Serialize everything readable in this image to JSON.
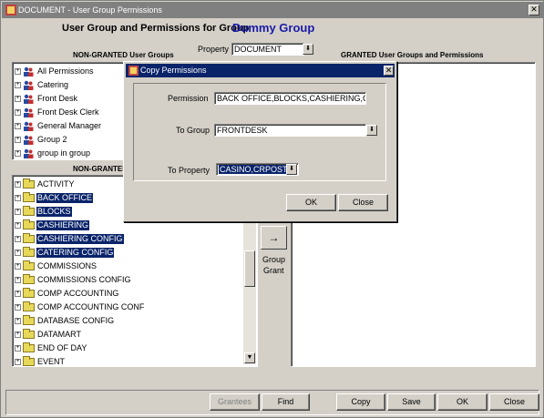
{
  "window": {
    "title": "DOCUMENT - User Group Permissions",
    "title_bar_color": "#808080"
  },
  "header": {
    "heading": "User Group and Permissions for Group",
    "group_name": "Dummy Group",
    "group_name_color": "#1a1aa8"
  },
  "property": {
    "label": "Property",
    "value": "DOCUMENT"
  },
  "panels": {
    "non_granted_groups_label": "NON-GRANTED User Groups",
    "granted_label": "GRANTED User Groups and Permissions",
    "non_granted_perms_label": "NON-GRANTED"
  },
  "user_groups": [
    {
      "label": "All Permissions",
      "selected": false
    },
    {
      "label": "Catering",
      "selected": false
    },
    {
      "label": "Front Desk",
      "selected": false
    },
    {
      "label": "Front Desk Clerk",
      "selected": false
    },
    {
      "label": "General Manager",
      "selected": false
    },
    {
      "label": "Group 2",
      "selected": false
    },
    {
      "label": "group in group",
      "selected": false
    }
  ],
  "permissions": [
    {
      "label": "ACTIVITY",
      "selected": false
    },
    {
      "label": "BACK OFFICE",
      "selected": true
    },
    {
      "label": "BLOCKS",
      "selected": true
    },
    {
      "label": "CASHIERING",
      "selected": true
    },
    {
      "label": "CASHIERING CONFIG",
      "selected": true
    },
    {
      "label": "CATERING CONFIG",
      "selected": true
    },
    {
      "label": "COMMISSIONS",
      "selected": false
    },
    {
      "label": "COMMISSIONS CONFIG",
      "selected": false
    },
    {
      "label": "COMP ACCOUNTING",
      "selected": false
    },
    {
      "label": "COMP ACCOUNTING CONF",
      "selected": false
    },
    {
      "label": "DATABASE CONFIG",
      "selected": false
    },
    {
      "label": "DATAMART",
      "selected": false
    },
    {
      "label": "END OF DAY",
      "selected": false
    },
    {
      "label": "EVENT",
      "selected": false
    }
  ],
  "grant": {
    "arrow": "→",
    "label_line1": "Group",
    "label_line2": "Grant"
  },
  "dialog": {
    "title": "Copy Permissions",
    "permission_label": "Permission",
    "permission_value": "BACK OFFICE,BLOCKS,CASHIERING,C",
    "to_group_label": "To Group",
    "to_group_value": "FRONTDESK",
    "to_property_label": "To  Property",
    "to_property_value": "CASINO,CRPOST",
    "ok_label": "OK",
    "close_label": "Close"
  },
  "footer": {
    "grantees_label": "Grantees",
    "find_label": "Find",
    "copy_label": "Copy",
    "save_label": "Save",
    "ok_label": "OK",
    "close_label": "Close"
  },
  "colors": {
    "selection": "#0a246a",
    "dialog_title": "#0a246a",
    "face": "#d4d0c8"
  }
}
